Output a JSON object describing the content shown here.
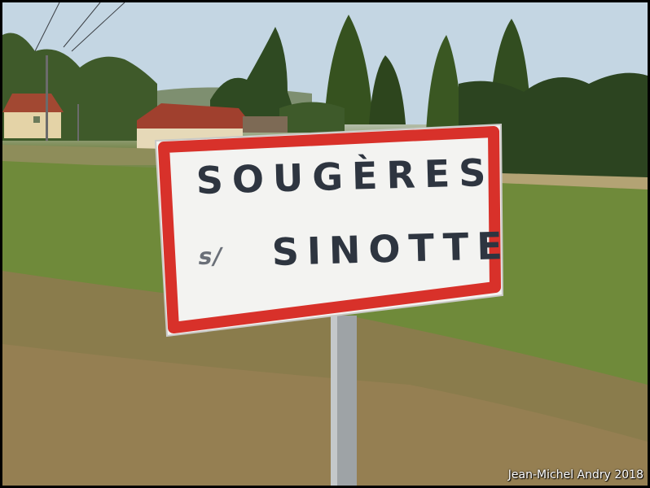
{
  "sign": {
    "line1": "SOUGÈRES",
    "prefix": "s/",
    "line2": "SINOTTE"
  },
  "credit": "Jean-Michel Andry 2018",
  "colors": {
    "sign_border": "#d8312a",
    "sign_face": "#f3f3f1",
    "sign_text": "#2e3540",
    "sky": "#c4d6e3",
    "grass": "#708a3c",
    "pole": "#9ea3a6"
  }
}
